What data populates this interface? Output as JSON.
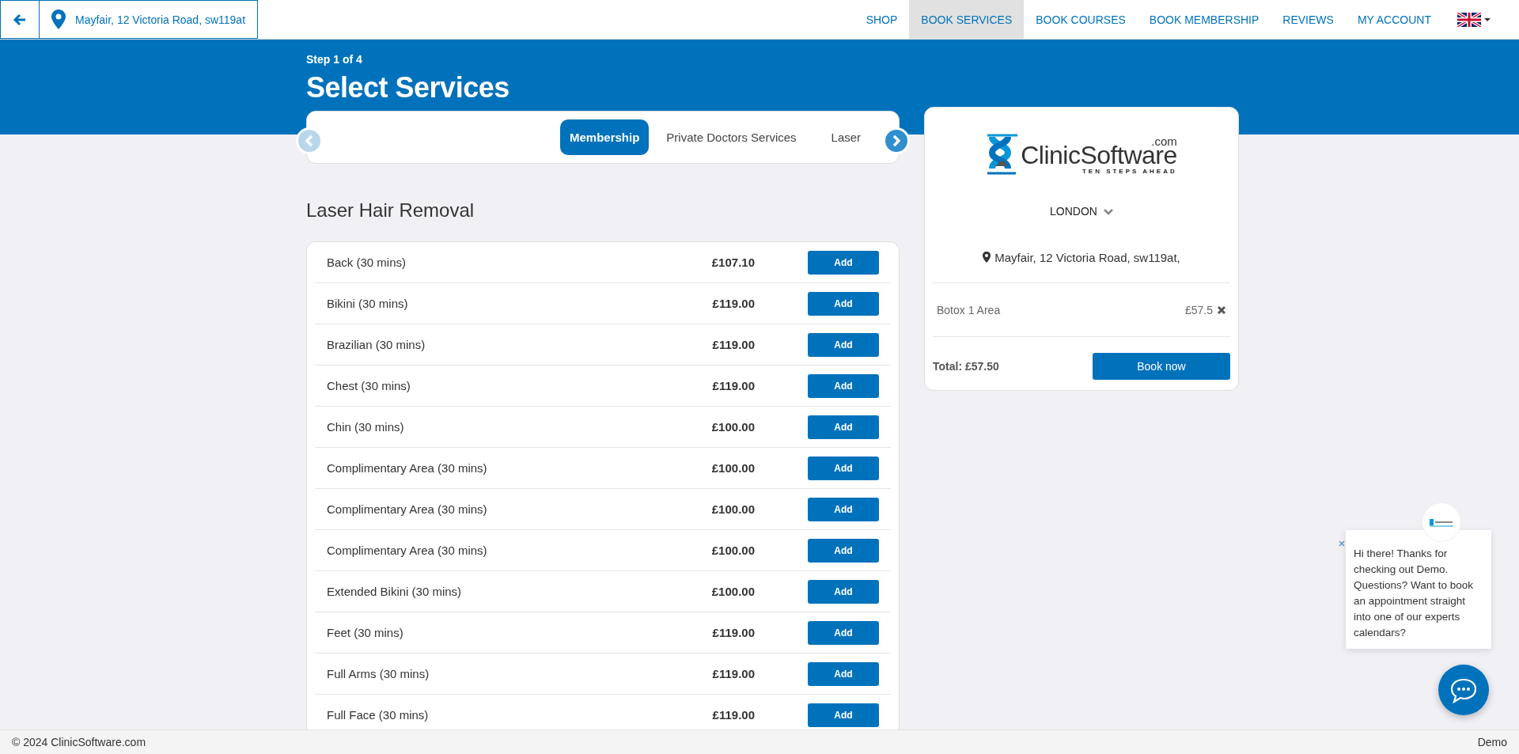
{
  "topbar": {
    "location": "Mayfair, 12 Victoria Road, sw119at",
    "nav": [
      {
        "label": "SHOP",
        "selected": false
      },
      {
        "label": "BOOK SERVICES",
        "selected": true
      },
      {
        "label": "BOOK COURSES",
        "selected": false
      },
      {
        "label": "BOOK MEMBERSHIP",
        "selected": false
      },
      {
        "label": "REVIEWS",
        "selected": false
      },
      {
        "label": "MY ACCOUNT",
        "selected": false
      }
    ]
  },
  "header": {
    "step": "Step 1 of 4",
    "title": "Select Services"
  },
  "category_tabs": {
    "prev_disabled": true,
    "next_disabled": false,
    "tabs": [
      {
        "label": "Membership",
        "selected": true
      },
      {
        "label": "Private Doctors Services",
        "selected": false
      },
      {
        "label": "Laser",
        "selected": false
      }
    ]
  },
  "section_title": "Laser Hair Removal",
  "services": [
    {
      "name": "Back (30 mins)",
      "price": "£107.10",
      "action": "Add"
    },
    {
      "name": "Bikini (30 mins)",
      "price": "£119.00",
      "action": "Add"
    },
    {
      "name": "Brazilian (30 mins)",
      "price": "£119.00",
      "action": "Add"
    },
    {
      "name": "Chest (30 mins)",
      "price": "£119.00",
      "action": "Add"
    },
    {
      "name": "Chin (30 mins)",
      "price": "£100.00",
      "action": "Add"
    },
    {
      "name": "Complimentary Area (30 mins)",
      "price": "£100.00",
      "action": "Add"
    },
    {
      "name": "Complimentary Area (30 mins)",
      "price": "£100.00",
      "action": "Add"
    },
    {
      "name": "Complimentary Area (30 mins)",
      "price": "£100.00",
      "action": "Add"
    },
    {
      "name": "Extended Bikini (30 mins)",
      "price": "£100.00",
      "action": "Add"
    },
    {
      "name": "Feet (30 mins)",
      "price": "£119.00",
      "action": "Add"
    },
    {
      "name": "Full Arms (30 mins)",
      "price": "£119.00",
      "action": "Add"
    },
    {
      "name": "Full Face (30 mins)",
      "price": "£119.00",
      "action": "Add"
    }
  ],
  "cart": {
    "logo": {
      "name": "ClinicSoftware",
      "suffix": ".com",
      "tagline": "TEN STEPS AHEAD"
    },
    "city": "LONDON",
    "address": "Mayfair, 12 Victoria Road, sw119at,",
    "items": [
      {
        "name": "Botox 1 Area",
        "price": "£57.5"
      }
    ],
    "total": "Total: £57.50",
    "book_button": "Book now"
  },
  "chat": {
    "message": "Hi there! Thanks for checking out Demo. Questions? Want to book an appointment straight into one of our experts calendars?"
  },
  "footer": {
    "copyright": "© 2024 ClinicSoftware.com",
    "right": "Demo"
  }
}
